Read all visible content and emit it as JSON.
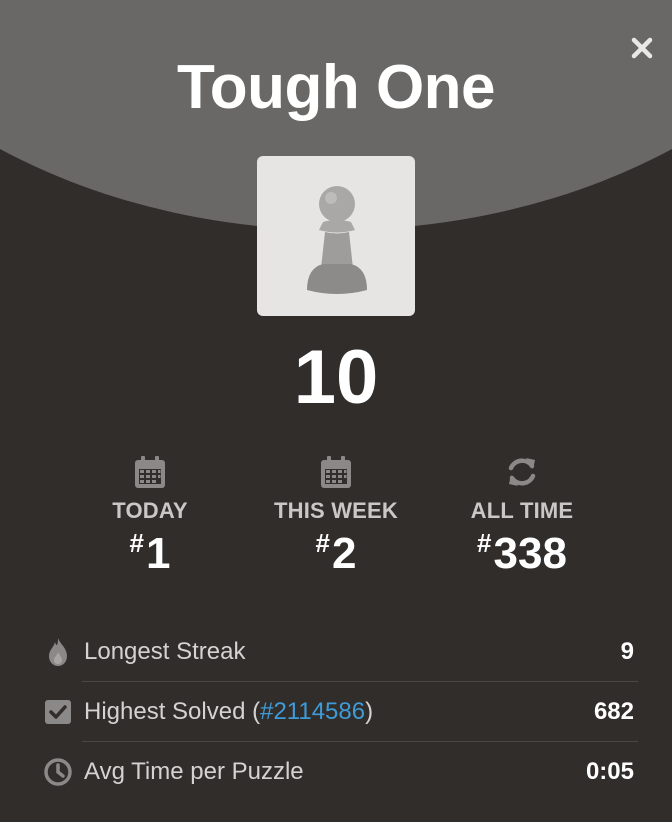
{
  "modal": {
    "title": "Tough One",
    "close_label": "×",
    "rating": "10"
  },
  "badge": {
    "icon": "pawn-icon",
    "background": "#e6e5e4"
  },
  "stats": [
    {
      "icon": "calendar-icon",
      "label": "TODAY",
      "hash": "#",
      "rank": "1"
    },
    {
      "icon": "calendar-icon",
      "label": "THIS WEEK",
      "hash": "#",
      "rank": "2"
    },
    {
      "icon": "refresh-icon",
      "label": "ALL TIME",
      "hash": "#",
      "rank": "338"
    }
  ],
  "details": {
    "streak": {
      "icon": "flame-icon",
      "label": "Longest Streak",
      "value": "9"
    },
    "highest": {
      "icon": "checkbox-icon",
      "label_prefix": "Highest Solved (",
      "link": "#2114586",
      "label_suffix": ")",
      "value": "682"
    },
    "avg_time": {
      "icon": "clock-icon",
      "label": "Avg Time per Puzzle",
      "value": "0:05"
    }
  },
  "colors": {
    "background": "#302d2b",
    "arc": "#6a6866",
    "link": "#3f9bd8"
  }
}
